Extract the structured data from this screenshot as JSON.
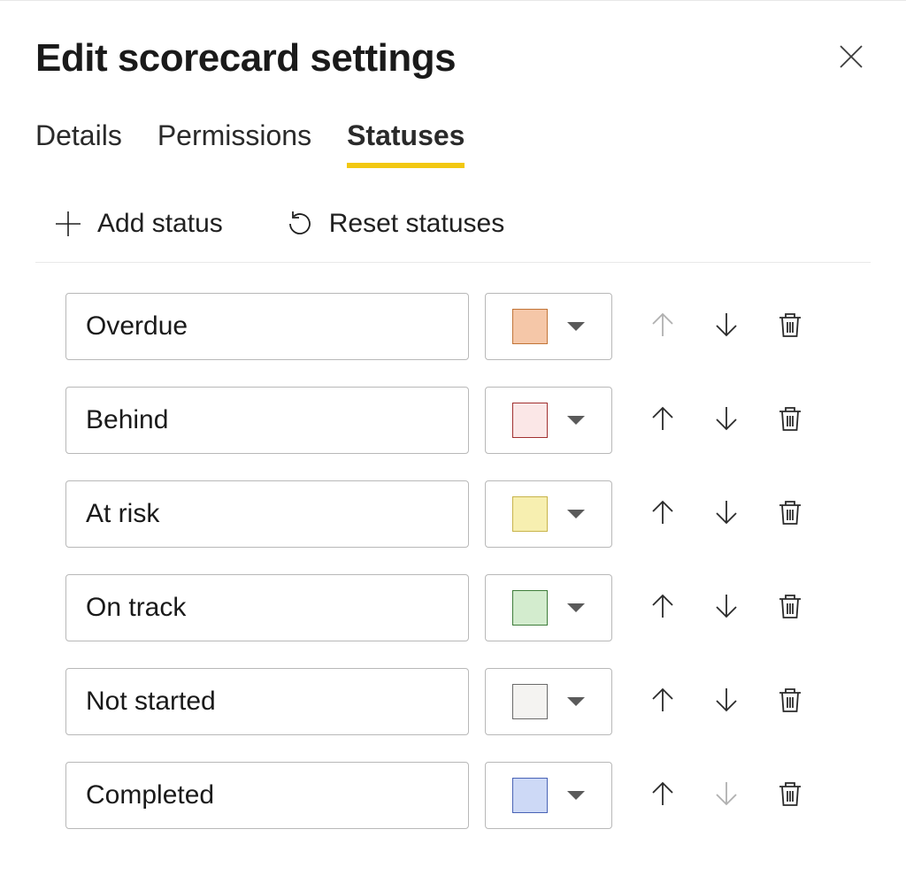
{
  "title": "Edit scorecard settings",
  "tabs": [
    {
      "label": "Details",
      "active": false
    },
    {
      "label": "Permissions",
      "active": false
    },
    {
      "label": "Statuses",
      "active": true
    }
  ],
  "toolbar": {
    "add_label": "Add status",
    "reset_label": "Reset statuses"
  },
  "statuses": [
    {
      "name": "Overdue",
      "fill": "#f5c7a8",
      "border": "#c27538",
      "up_disabled": true,
      "down_disabled": false
    },
    {
      "name": "Behind",
      "fill": "#fbe7e7",
      "border": "#a13030",
      "up_disabled": false,
      "down_disabled": false
    },
    {
      "name": "At risk",
      "fill": "#f7efb0",
      "border": "#c8b44a",
      "up_disabled": false,
      "down_disabled": false
    },
    {
      "name": "On track",
      "fill": "#d3ecce",
      "border": "#3e7d3a",
      "up_disabled": false,
      "down_disabled": false
    },
    {
      "name": "Not started",
      "fill": "#f4f3f1",
      "border": "#6a6a6a",
      "up_disabled": false,
      "down_disabled": false
    },
    {
      "name": "Completed",
      "fill": "#cdd9f6",
      "border": "#4963b6",
      "up_disabled": false,
      "down_disabled": true
    }
  ]
}
